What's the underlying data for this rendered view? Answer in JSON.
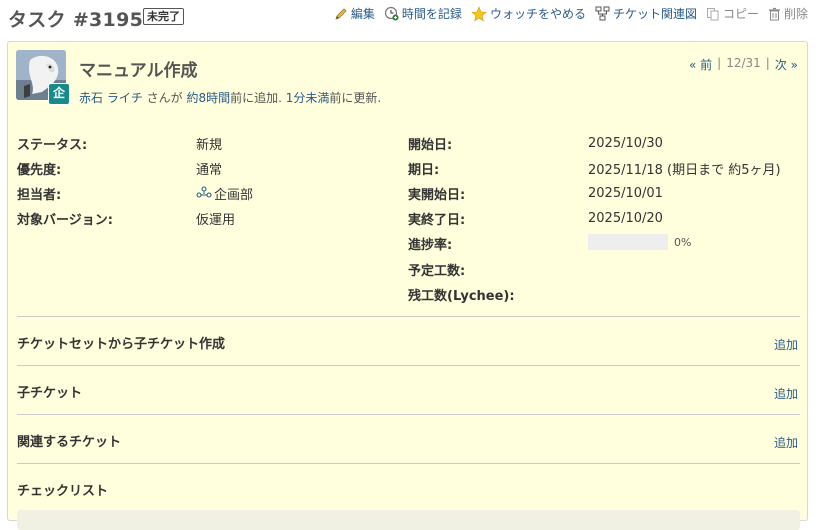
{
  "header": {
    "title": "タスク #3195",
    "status_badge": "未完了",
    "actions": {
      "edit": "編集",
      "log_time": "時間を記録",
      "unwatch": "ウォッチをやめる",
      "relations_graph": "チケット関連図",
      "copy": "コピー",
      "delete": "削除"
    }
  },
  "issue": {
    "subject": "マニュアル作成",
    "avatar_badge": "企",
    "author": {
      "name": "赤石 ライチ",
      "san": " さんが ",
      "added_ago": "約8時間",
      "added_suffix": "前に追加. ",
      "updated_ago": "1分未満",
      "updated_suffix": "前に更新."
    },
    "pager": {
      "prev": "« 前",
      "sep1": "|",
      "position": "12/31",
      "sep2": "|",
      "next": "次 »"
    }
  },
  "attributes": {
    "status_label": "ステータス:",
    "status_value": "新規",
    "priority_label": "優先度:",
    "priority_value": "通常",
    "assignee_label": "担当者:",
    "assignee_value": "企画部",
    "version_label": "対象バージョン:",
    "version_value": "仮運用",
    "start_label": "開始日:",
    "start_value": "2025/10/30",
    "due_label": "期日:",
    "due_value": "2025/11/18 (期日まで 約5ヶ月)",
    "actual_start_label": "実開始日:",
    "actual_start_value": "2025/10/01",
    "actual_end_label": "実終了日:",
    "actual_end_value": "2025/10/20",
    "progress_label": "進捗率:",
    "progress_value": 0,
    "progress_text": "0%",
    "estimated_label": "予定工数:",
    "remaining_label": "残工数(Lychee):"
  },
  "sections": {
    "ticketset_title": "チケットセットから子チケット作成",
    "ticketset_add": "追加",
    "subtasks_title": "子チケット",
    "subtasks_add": "追加",
    "relations_title": "関連するチケット",
    "relations_add": "追加",
    "checklist_title": "チェックリスト"
  },
  "colors": {
    "issue_background": "#ffffdd",
    "link": "#2a5a8a",
    "avatar_badge": "#168b89"
  }
}
